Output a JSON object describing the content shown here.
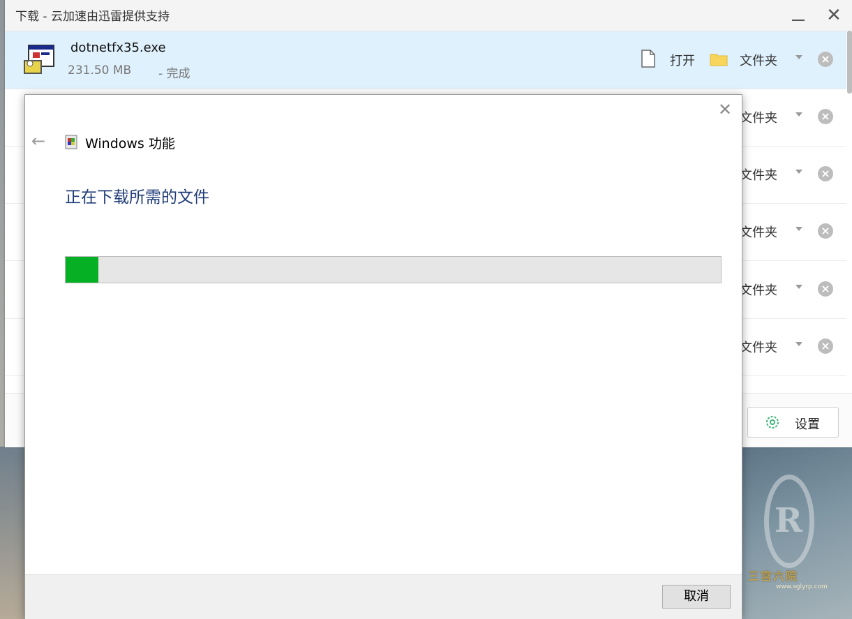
{
  "download_window": {
    "title": "下载 - 云加速由迅雷提供支持",
    "rows": [
      {
        "name": "dotnetfx35.exe",
        "size": "231.50 MB",
        "status": "- 完成",
        "open": "打开",
        "folder": "文件夹"
      },
      {
        "folder": "文件夹"
      },
      {
        "folder": "文件夹"
      },
      {
        "folder": "文件夹"
      },
      {
        "folder": "文件夹"
      },
      {
        "folder": "文件夹"
      }
    ],
    "settings_label": "设置"
  },
  "dialog": {
    "title": "Windows 功能",
    "heading": "正在下载所需的文件",
    "progress_percent": 5,
    "cancel_label": "取消"
  },
  "desktop": {
    "watermark": "三宫六院",
    "watermark_sub": "www.sglyrp.com"
  },
  "colors": {
    "progress_fill": "#06b025",
    "heading": "#1f3c78",
    "selected_row": "#dff1fc"
  },
  "icons": [
    "installer-exe-icon",
    "file-icon",
    "folder-icon",
    "caret-down-icon",
    "remove-icon",
    "gear-icon",
    "back-arrow-icon",
    "windows-features-icon",
    "close-icon",
    "minimize-icon"
  ]
}
